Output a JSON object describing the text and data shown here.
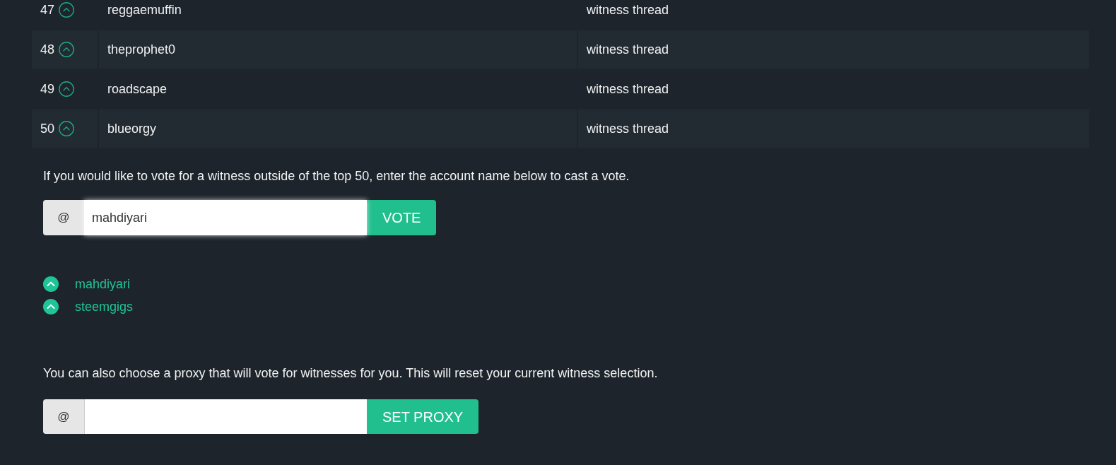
{
  "witness_table": {
    "rows": [
      {
        "rank": "47",
        "voted": false,
        "name": "reggaemuffin",
        "link": "witness thread"
      },
      {
        "rank": "48",
        "voted": false,
        "name": "theprophet0",
        "link": "witness thread"
      },
      {
        "rank": "49",
        "voted": false,
        "name": "roadscape",
        "link": "witness thread"
      },
      {
        "rank": "50",
        "voted": false,
        "name": "blueorgy",
        "link": "witness thread"
      }
    ]
  },
  "vote_form": {
    "prompt": "If you would like to vote for a witness outside of the top 50, enter the account name below to cast a vote.",
    "prefix": "@",
    "value": "mahdiyari",
    "focused": true,
    "button": "VOTE"
  },
  "voted_witnesses": [
    {
      "name": "mahdiyari",
      "voted": true
    },
    {
      "name": "steemgigs",
      "voted": true
    }
  ],
  "proxy_form": {
    "prompt": "You can also choose a proxy that will vote for witnesses for you. This will reset your current witness selection.",
    "prefix": "@",
    "focused": false,
    "button": "SET PROXY"
  }
}
